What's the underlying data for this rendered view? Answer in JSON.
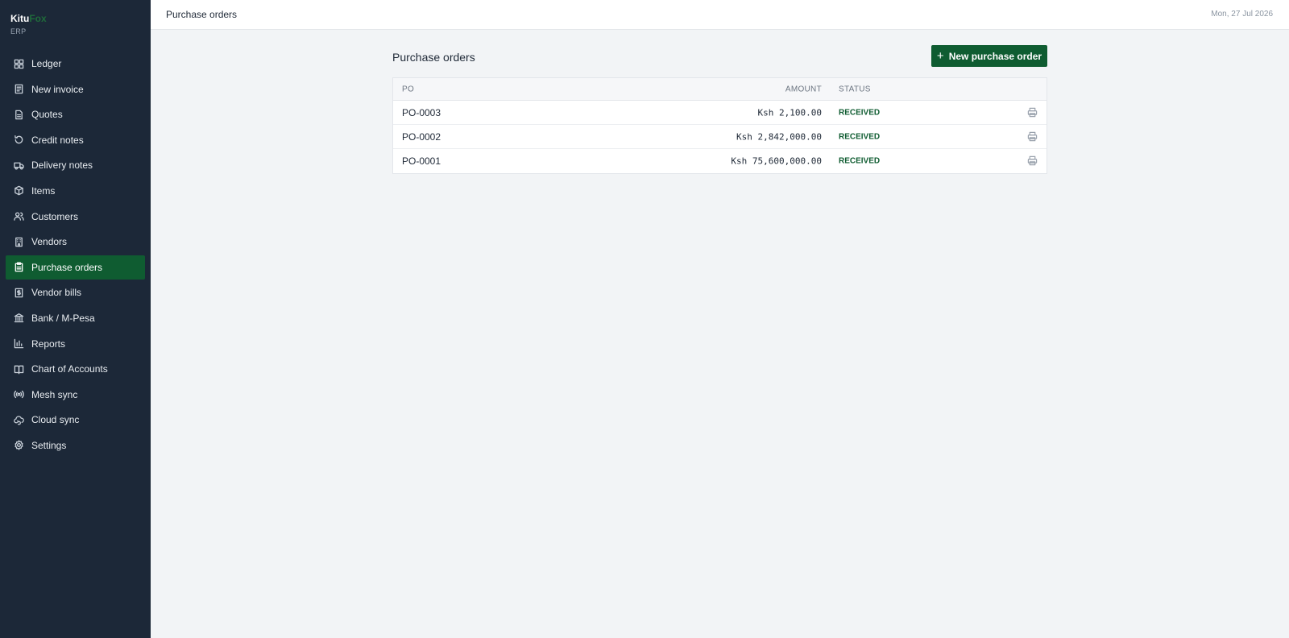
{
  "brand": {
    "name_part1": "Kitu",
    "name_part2": "Fox",
    "subtitle": "ERP",
    "accent_color": "#1f6b3a"
  },
  "sidebar": {
    "items": [
      {
        "label": "Ledger",
        "icon": "grid-icon",
        "active": false
      },
      {
        "label": "New invoice",
        "icon": "invoice-icon",
        "active": false
      },
      {
        "label": "Quotes",
        "icon": "document-icon",
        "active": false
      },
      {
        "label": "Credit notes",
        "icon": "undo-icon",
        "active": false
      },
      {
        "label": "Delivery notes",
        "icon": "truck-icon",
        "active": false
      },
      {
        "label": "Items",
        "icon": "box-icon",
        "active": false
      },
      {
        "label": "Customers",
        "icon": "users-icon",
        "active": false
      },
      {
        "label": "Vendors",
        "icon": "building-icon",
        "active": false
      },
      {
        "label": "Purchase orders",
        "icon": "clipboard-icon",
        "active": true
      },
      {
        "label": "Vendor bills",
        "icon": "bill-icon",
        "active": false
      },
      {
        "label": "Bank / M-Pesa",
        "icon": "bank-icon",
        "active": false
      },
      {
        "label": "Reports",
        "icon": "bar-chart-icon",
        "active": false
      },
      {
        "label": "Chart of Accounts",
        "icon": "book-icon",
        "active": false
      },
      {
        "label": "Mesh sync",
        "icon": "radio-icon",
        "active": false
      },
      {
        "label": "Cloud sync",
        "icon": "cloud-sync-icon",
        "active": false
      },
      {
        "label": "Settings",
        "icon": "gear-icon",
        "active": false
      }
    ]
  },
  "header": {
    "title": "Purchase orders",
    "date": "Mon, 27 Jul 2026"
  },
  "main": {
    "title": "Purchase orders",
    "new_button_label": "New purchase order",
    "table": {
      "columns": {
        "po": "PO",
        "amount": "AMOUNT",
        "status": "STATUS"
      },
      "rows": [
        {
          "po": "PO-0003",
          "amount": "Ksh 2,100.00",
          "status": "RECEIVED"
        },
        {
          "po": "PO-0002",
          "amount": "Ksh 2,842,000.00",
          "status": "RECEIVED"
        },
        {
          "po": "PO-0001",
          "amount": "Ksh 75,600,000.00",
          "status": "RECEIVED"
        }
      ]
    }
  },
  "colors": {
    "sidebar_bg": "#1c2838",
    "active_green": "#0f5c31",
    "status_green": "#0f5c31",
    "page_bg": "#f2f4f6"
  }
}
